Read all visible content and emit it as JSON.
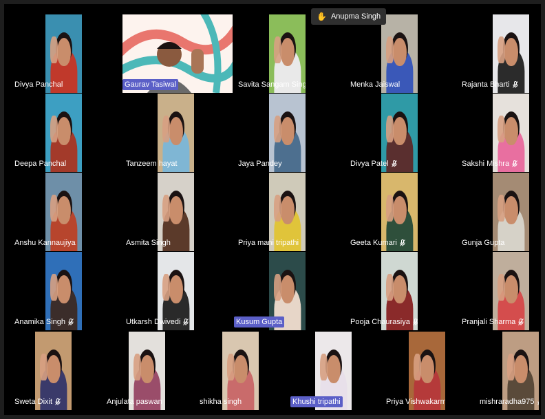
{
  "raised_hand": {
    "icon": "raised-hand-icon",
    "name": "Anupma Singh"
  },
  "participants": [
    {
      "name": "Divya Panchal",
      "muted": false,
      "speaking": false,
      "bg": "#3a8fb0"
    },
    {
      "name": "Gaurav Tasiwal",
      "muted": false,
      "speaking": true,
      "bg": "#fdf3ee"
    },
    {
      "name": "Savita Sangam Singh",
      "muted": true,
      "speaking": false,
      "bg": "#8bbd5a"
    },
    {
      "name": "Menka Jaiswal",
      "muted": false,
      "speaking": false,
      "bg": "#b7b2a6"
    },
    {
      "name": "Rajanta Bharti",
      "muted": true,
      "speaking": false,
      "bg": "#e7e7ea"
    },
    {
      "name": "Deepa Panchal",
      "muted": false,
      "speaking": false,
      "bg": "#3d9fc2"
    },
    {
      "name": "Tanzeem hayat",
      "muted": false,
      "speaking": false,
      "bg": "#c9b08a"
    },
    {
      "name": "Jaya Pandey",
      "muted": false,
      "speaking": false,
      "bg": "#b8c3d1"
    },
    {
      "name": "Divya Patel",
      "muted": true,
      "speaking": false,
      "bg": "#2f9aa6"
    },
    {
      "name": "Sakshi Mishra",
      "muted": true,
      "speaking": false,
      "bg": "#e6e1dc"
    },
    {
      "name": "Anshu Kannaujiya",
      "muted": false,
      "speaking": false,
      "bg": "#6e8fa8"
    },
    {
      "name": "Asmita Singh",
      "muted": false,
      "speaking": false,
      "bg": "#d6d1c9"
    },
    {
      "name": "Priya mani tripathi",
      "muted": false,
      "speaking": false,
      "bg": "#cfcab9"
    },
    {
      "name": "Geeta Kumari",
      "muted": true,
      "speaking": false,
      "bg": "#d8b76c"
    },
    {
      "name": "Gunja Gupta",
      "muted": false,
      "speaking": false,
      "bg": "#a48b74"
    },
    {
      "name": "Anamika Singh",
      "muted": true,
      "speaking": false,
      "bg": "#2f6fb8"
    },
    {
      "name": "Utkarsh Dwivedi",
      "muted": true,
      "speaking": false,
      "bg": "#e4e6e8"
    },
    {
      "name": "Kusum Gupta",
      "muted": false,
      "speaking": true,
      "bg": "#2c4b4a"
    },
    {
      "name": "Pooja Chaurasiya",
      "muted": true,
      "speaking": false,
      "bg": "#cfd8d2"
    },
    {
      "name": "Pranjali Sharma",
      "muted": true,
      "speaking": false,
      "bg": "#bfae9c"
    },
    {
      "name": "Sweta Dixit",
      "muted": true,
      "speaking": false,
      "bg": "#c29a70"
    },
    {
      "name": "Anjulata paswan",
      "muted": true,
      "speaking": false,
      "bg": "#e3e0dc"
    },
    {
      "name": "shikha singh",
      "muted": false,
      "speaking": false,
      "bg": "#d9c7b0"
    },
    {
      "name": "Khushi tripathi",
      "muted": false,
      "speaking": true,
      "bg": "#ece8ea"
    },
    {
      "name": "Priya Vishwakarma",
      "muted": true,
      "speaking": false,
      "bg": "#a8683a"
    },
    {
      "name": "mishraradha975",
      "muted": true,
      "speaking": false,
      "bg": "#bd9d83"
    }
  ]
}
